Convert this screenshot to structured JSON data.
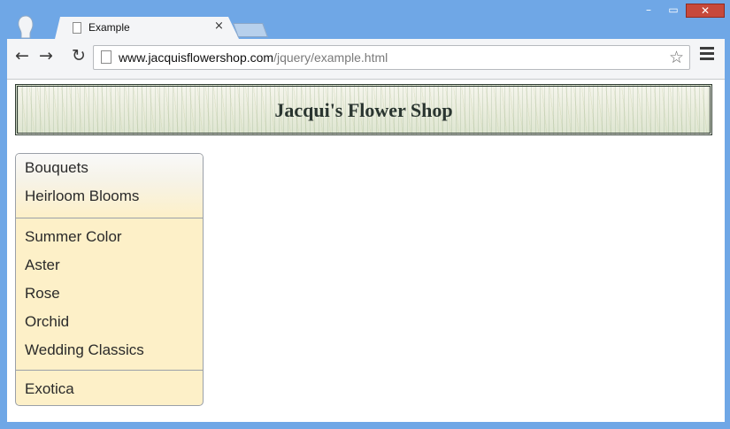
{
  "browser": {
    "tab_title": "Example",
    "tab_close": "×",
    "url_host": "www.jacquisflowershop.com",
    "url_path": "/jquery/example.html",
    "window_controls": {
      "minimize": "–",
      "maximize": "▭",
      "close": "✕"
    },
    "accent_color": "#6fa7e6"
  },
  "page": {
    "banner_title": "Jacqui's Flower Shop",
    "menu": {
      "group1": [
        "Bouquets",
        "Heirloom Blooms"
      ],
      "group2": [
        "Summer Color",
        "Aster",
        "Rose",
        "Orchid",
        "Wedding Classics"
      ],
      "group3": [
        "Exotica"
      ]
    },
    "menu_background": "#fdf0c8"
  }
}
